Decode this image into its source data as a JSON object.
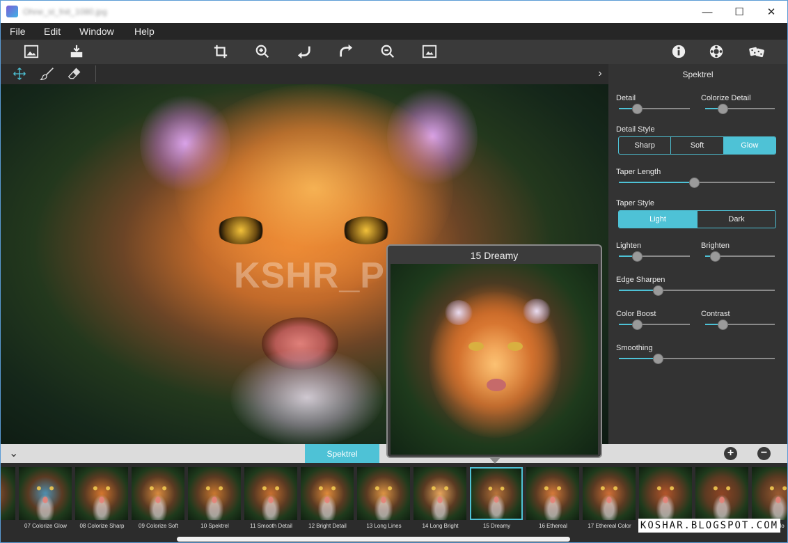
{
  "window": {
    "doc_title": "Ohne_st_fnit_1080.jpg",
    "minimize": "—",
    "maximize": "☐",
    "close": "✕"
  },
  "menu": [
    "File",
    "Edit",
    "Window",
    "Help"
  ],
  "panel": {
    "title": "Spektrel",
    "labels": {
      "detail": "Detail",
      "colorize_detail": "Colorize Detail",
      "detail_style": "Detail Style",
      "taper_length": "Taper Length",
      "taper_style": "Taper Style",
      "lighten": "Lighten",
      "brighten": "Brighten",
      "edge_sharpen": "Edge Sharpen",
      "color_boost": "Color Boost",
      "contrast": "Contrast",
      "smoothing": "Smoothing"
    },
    "detail_style_options": [
      "Sharp",
      "Soft",
      "Glow"
    ],
    "detail_style_selected": "Glow",
    "taper_style_options": [
      "Light",
      "Dark"
    ],
    "taper_style_selected": "Light",
    "slider_values": {
      "detail": 0.25,
      "colorize_detail": 0.25,
      "taper_length": 0.48,
      "lighten": 0.25,
      "brighten": 0.14,
      "edge_sharpen": 0.25,
      "color_boost": 0.25,
      "contrast": 0.25,
      "smoothing": 0.25
    }
  },
  "canvas": {
    "watermark": "KSHR_PORTABLE"
  },
  "popup": {
    "title": "15 Dreamy"
  },
  "strip": {
    "tab": "Spektrel",
    "add": "+",
    "remove": "−",
    "credit": "KOSHAR.BLOGSPOT.COM",
    "presets": [
      {
        "label": "",
        "tint": "#a86a3a"
      },
      {
        "label": "07 Colorize Glow",
        "tint": "#4f8fb0"
      },
      {
        "label": "08 Colorize Sharp",
        "tint": "#d5762e"
      },
      {
        "label": "09 Colorize Soft",
        "tint": "#d98a3e"
      },
      {
        "label": "10 Spektrel",
        "tint": "#c9782f"
      },
      {
        "label": "11 Smooth Detail",
        "tint": "#c87030"
      },
      {
        "label": "12 Bright Detail",
        "tint": "#e08a3a"
      },
      {
        "label": "13 Long Lines",
        "tint": "#dd9444"
      },
      {
        "label": "14 Long Bright",
        "tint": "#e6a45c"
      },
      {
        "label": "15 Dreamy",
        "tint": "#b9743a"
      },
      {
        "label": "16 Ethereal",
        "tint": "#d67a3a"
      },
      {
        "label": "17 Ethereal Color",
        "tint": "#cf6e36"
      },
      {
        "label": "",
        "tint": "#b3552a"
      },
      {
        "label": "",
        "tint": "#8e4424"
      },
      {
        "label": "Colo",
        "tint": "#9a5a30"
      }
    ],
    "selected": "15 Dreamy"
  },
  "colors": {
    "accent": "#4ec2d6",
    "panel_bg": "#333333",
    "toolbar_bg": "#3a3a3a"
  }
}
